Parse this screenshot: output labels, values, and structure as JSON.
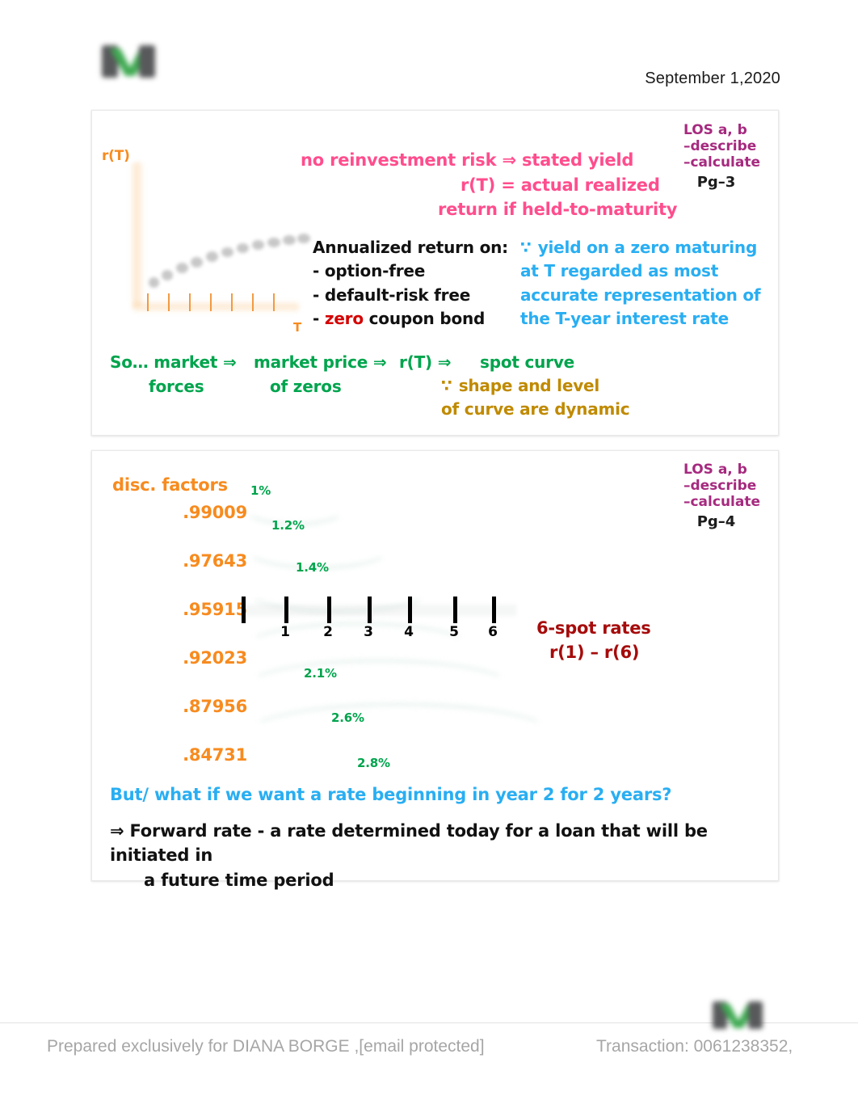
{
  "header": {
    "date": "September 1,2020",
    "logo_name": "brand-logo"
  },
  "panel1": {
    "los": {
      "title": "LOS a, b",
      "item1": "–describe",
      "item2": "–calculate",
      "page": "Pg–3"
    },
    "graph": {
      "y_label": "r(T)",
      "x_label": "T",
      "tick_count": 8,
      "curve_point_count": 11
    },
    "pink_note": {
      "line1": "no reinvestment risk ⇒ stated yield",
      "line2": "r(T) = actual realized",
      "line3": "return if held-to-maturity"
    },
    "black_list": {
      "heading": "Annualized return on:",
      "item1": "- option-free",
      "item2": "- default-risk free",
      "item3_prefix": "- ",
      "item3_highlight": "zero",
      "item3_suffix": " coupon bond"
    },
    "cyan_note": {
      "symbol": "∵",
      "line1": "yield on a zero maturing",
      "line2": "at T regarded as most",
      "line3": "accurate representation of",
      "line4": "the T-year interest rate"
    },
    "green_chain": {
      "a1": "So… market ⇒",
      "a2": "forces",
      "b1": "market price ⇒",
      "b2": "of zeros",
      "c1": "r(T)  ⇒",
      "d1": "spot curve"
    },
    "olive_note": {
      "symbol": "∵",
      "line1": "shape and level",
      "line2": "of curve are dynamic"
    }
  },
  "panel2": {
    "los": {
      "title": "LOS a, b",
      "item1": "–describe",
      "item2": "–calculate",
      "page": "Pg–4"
    },
    "disc_factors": {
      "title": "disc. factors",
      "values": [
        ".99009",
        ".97643",
        ".95915",
        ".92023",
        ".87956",
        ".84731"
      ]
    },
    "rates": [
      "1%",
      "1.2%",
      "1.4%",
      "2.1%",
      "2.6%",
      "2.8%"
    ],
    "timeline": {
      "labels": [
        "1",
        "2",
        "3",
        "4",
        "5",
        "6"
      ],
      "tick_count": 7
    },
    "spot_note": {
      "line1": "6-spot rates",
      "line2": "r(1) – r(6)"
    },
    "question": "But/ what if we want a rate beginning in year 2 for 2 years?",
    "forward": {
      "line1": "⇒ Forward rate - a rate determined today for a loan that will be initiated in",
      "line2": "a future time period"
    }
  },
  "footer": {
    "left": "Prepared exclusively for DIANA BORGE ,[email protected]",
    "right": "Transaction: 0061238352,"
  },
  "colors": {
    "pink": "#ff4d8d",
    "cyan": "#29aef2",
    "green": "#00a44d",
    "orange": "#f78b1f",
    "magenta": "#a62a7f",
    "olive": "#c08a00",
    "dark_red": "#a60b0b",
    "red": "#d40000",
    "black": "#111111",
    "footer_gray": "#a6a6a6"
  }
}
